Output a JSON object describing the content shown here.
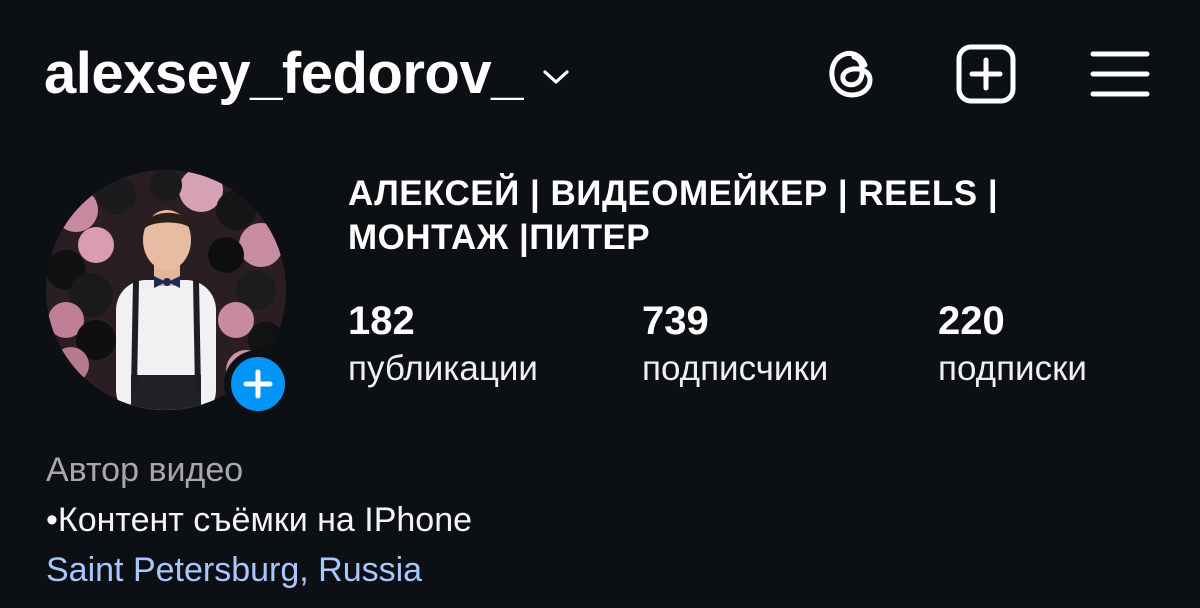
{
  "header": {
    "username": "alexsey_fedorov_",
    "icons": [
      "chevron-down-icon",
      "threads-icon",
      "create-post-icon",
      "menu-icon"
    ]
  },
  "profile": {
    "full_name": "АЛЕКСЕЙ | ВИДЕОМЕЙКЕР | REELS | МОНТАЖ |ПИТЕР",
    "stats": [
      {
        "value": "182",
        "label": "публикации"
      },
      {
        "value": "739",
        "label": "подписчики"
      },
      {
        "value": "220",
        "label": "подписки"
      }
    ],
    "category": "Автор видео",
    "bio": "•Контент съёмки на IPhone",
    "location": "Saint Petersburg, Russia"
  },
  "colors": {
    "background": "#0c0f14",
    "accent_blue": "#0095f6",
    "link": "#a9c7ff",
    "secondary_text": "#a8a8a8"
  }
}
